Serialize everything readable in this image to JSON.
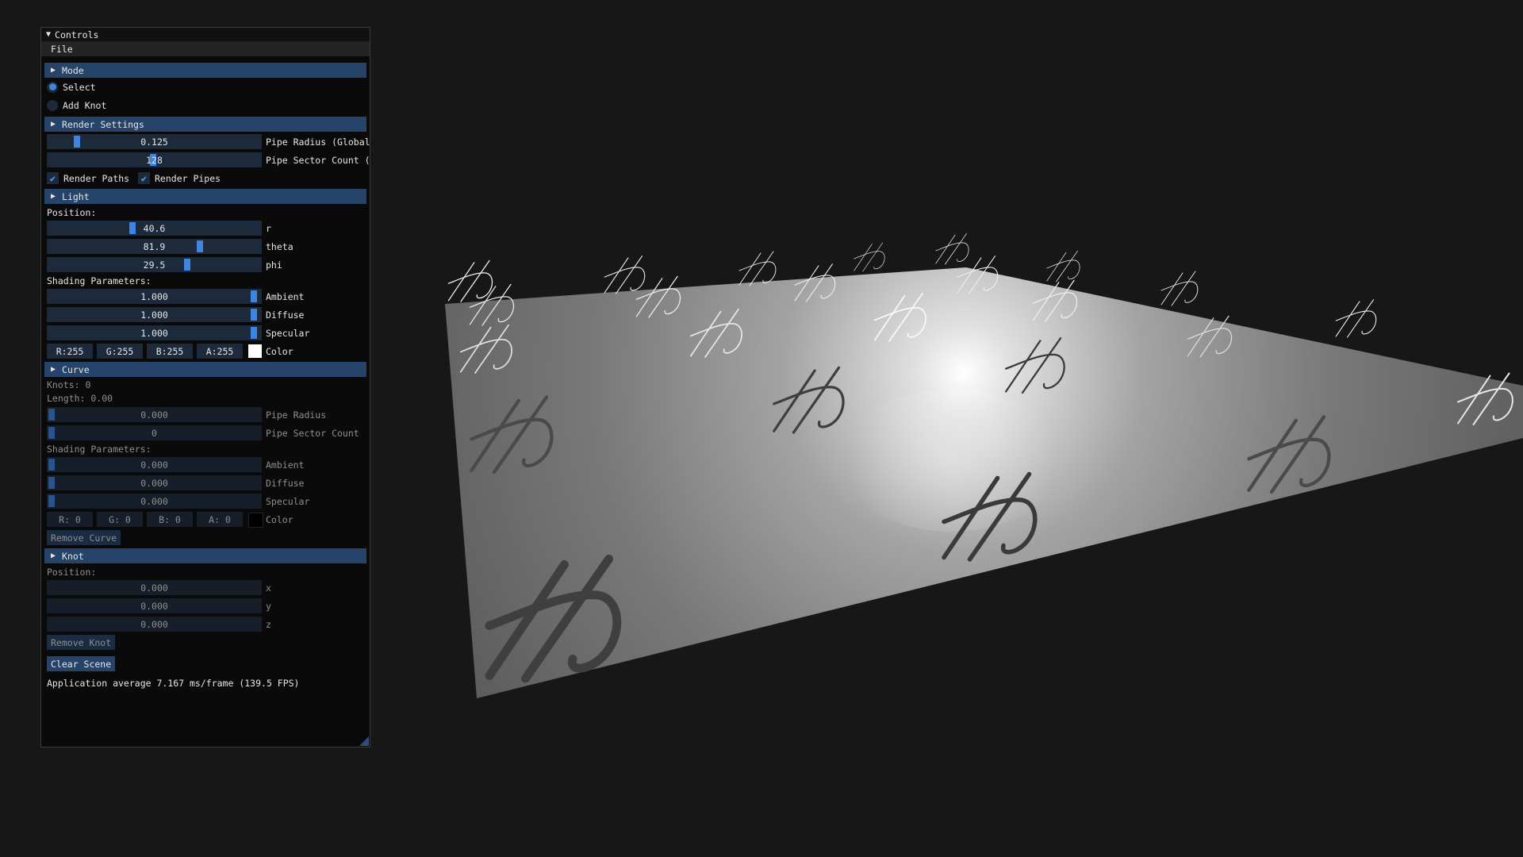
{
  "window": {
    "title": "Controls"
  },
  "menu": {
    "file": "File"
  },
  "mode": {
    "header": "Mode",
    "options": [
      {
        "label": "Select",
        "selected": true
      },
      {
        "label": "Add Knot",
        "selected": false
      }
    ]
  },
  "render_settings": {
    "header": "Render Settings",
    "pipe_radius": {
      "value": "0.125",
      "label": "Pipe Radius (Global"
    },
    "pipe_sector_count": {
      "value": "128",
      "label": "Pipe Sector Count ("
    },
    "render_paths": {
      "label": "Render Paths",
      "checked": true
    },
    "render_pipes": {
      "label": "Render Pipes",
      "checked": true
    }
  },
  "light": {
    "header": "Light",
    "position_label": "Position:",
    "r": {
      "value": "40.6",
      "label": "r"
    },
    "theta": {
      "value": "81.9",
      "label": "theta"
    },
    "phi": {
      "value": "29.5",
      "label": "phi"
    },
    "shading_label": "Shading Parameters:",
    "ambient": {
      "value": "1.000",
      "label": "Ambient"
    },
    "diffuse": {
      "value": "1.000",
      "label": "Diffuse"
    },
    "specular": {
      "value": "1.000",
      "label": "Specular"
    },
    "color": {
      "r": "R:255",
      "g": "G:255",
      "b": "B:255",
      "a": "A:255",
      "label": "Color",
      "swatch": "#ffffff"
    }
  },
  "curve": {
    "header": "Curve",
    "knots": "Knots: 0",
    "length": "Length: 0.00",
    "pipe_radius": {
      "value": "0.000",
      "label": "Pipe Radius"
    },
    "pipe_sector_count": {
      "value": "0",
      "label": "Pipe Sector Count"
    },
    "shading_label": "Shading Parameters:",
    "ambient": {
      "value": "0.000",
      "label": "Ambient"
    },
    "diffuse": {
      "value": "0.000",
      "label": "Diffuse"
    },
    "specular": {
      "value": "0.000",
      "label": "Specular"
    },
    "color": {
      "r": "R:  0",
      "g": "G:  0",
      "b": "B:  0",
      "a": "A:  0",
      "label": "Color",
      "swatch": "#000000"
    },
    "remove": "Remove Curve"
  },
  "knot": {
    "header": "Knot",
    "position_label": "Position:",
    "x": {
      "value": "0.000",
      "label": "x"
    },
    "y": {
      "value": "0.000",
      "label": "y"
    },
    "z": {
      "value": "0.000",
      "label": "z"
    },
    "remove": "Remove Knot"
  },
  "clear_scene": "Clear Scene",
  "status": "Application average 7.167 ms/frame (139.5 FPS)",
  "colors": {
    "accent": "#3d85e0",
    "header": "#26436a",
    "frame": "#1d2a3c",
    "background": "#171717"
  }
}
